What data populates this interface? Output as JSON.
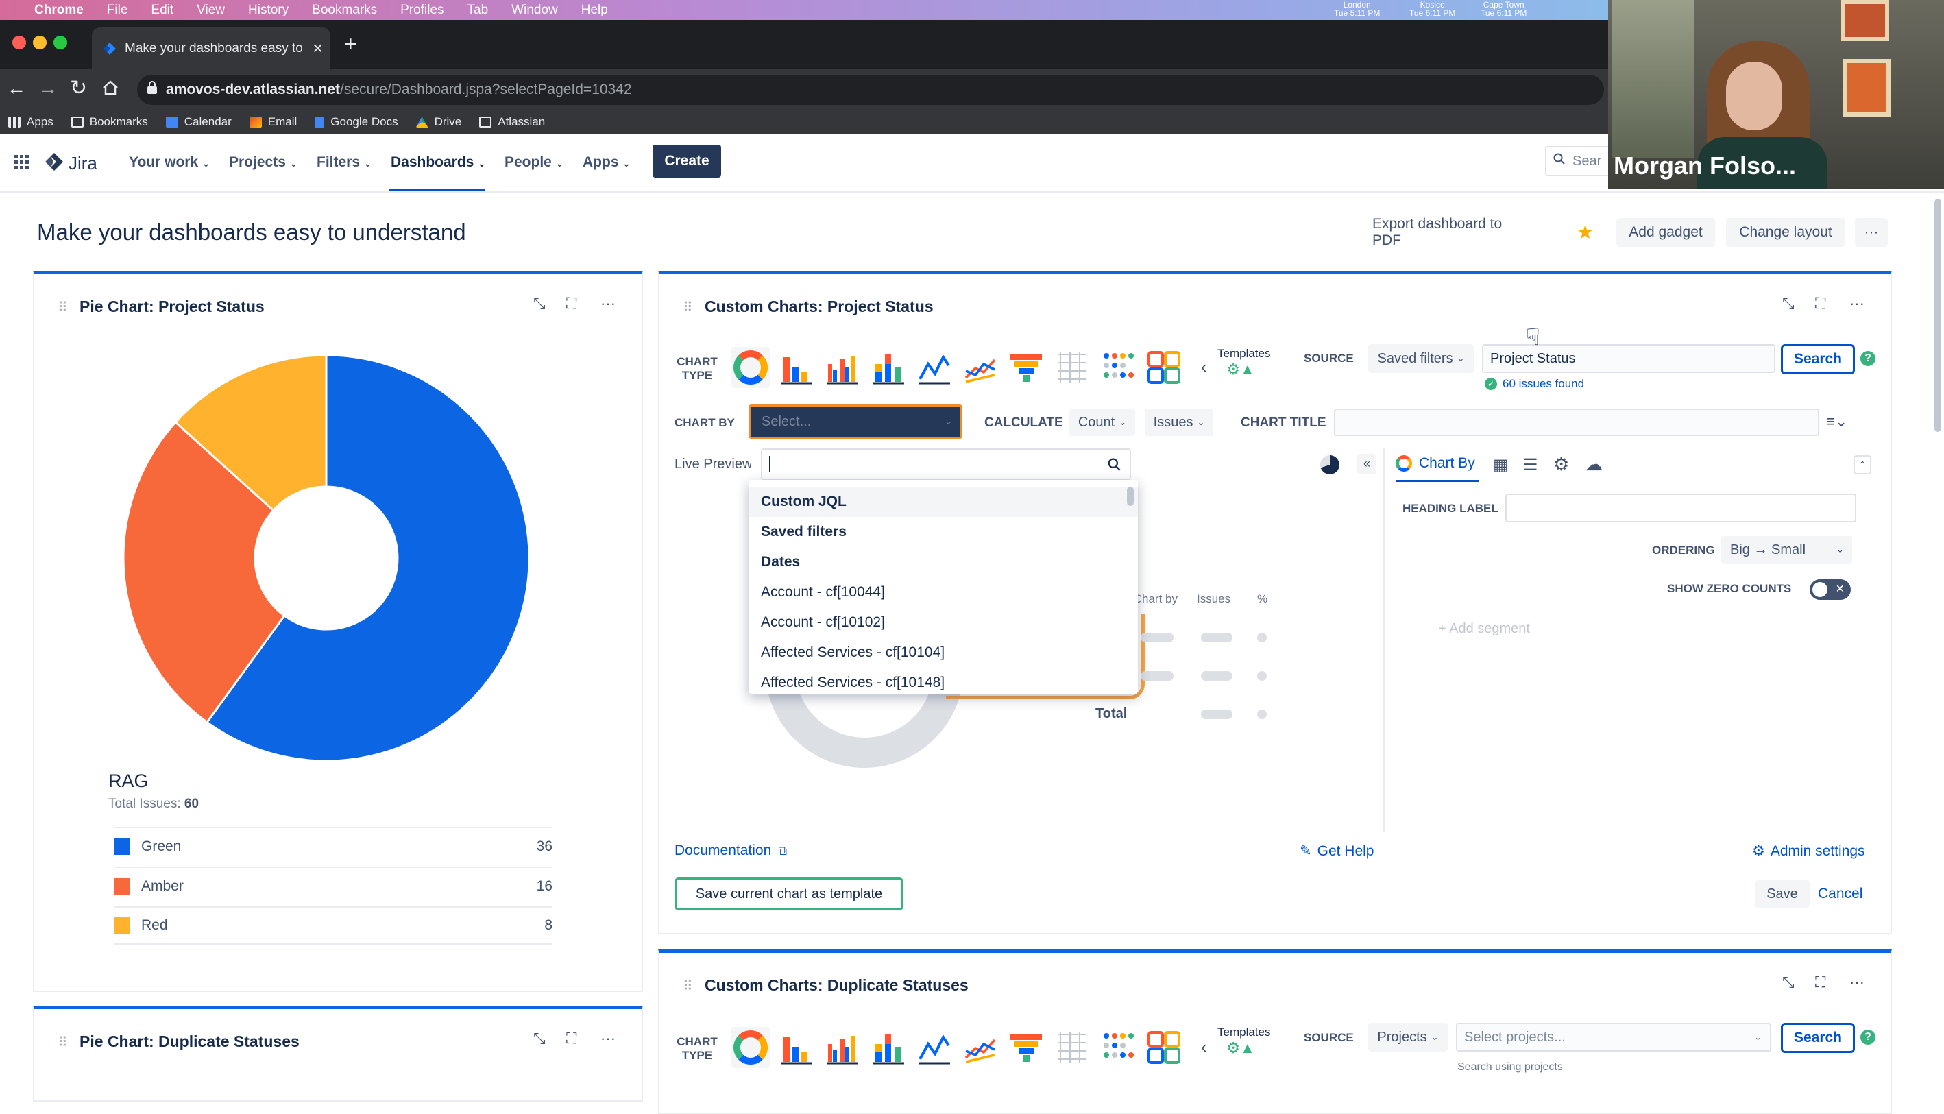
{
  "mac_menu": {
    "app": "Chrome",
    "items": [
      "File",
      "Edit",
      "View",
      "History",
      "Bookmarks",
      "Profiles",
      "Tab",
      "Window",
      "Help"
    ],
    "clocks": [
      {
        "city": "London",
        "time": "Tue 5:11 PM"
      },
      {
        "city": "Kosice",
        "time": "Tue 6:11 PM"
      },
      {
        "city": "Cape Town",
        "time": "Tue 6:11 PM"
      }
    ]
  },
  "browser": {
    "tab_title": "Make your dashboards easy to",
    "tab_close": "×",
    "new_tab": "+",
    "url_host": "amovos-dev.atlassian.net",
    "url_path": "/secure/Dashboard.jspa?selectPageId=10342",
    "bookmarks": [
      "Apps",
      "Bookmarks",
      "Calendar",
      "Email",
      "Google Docs",
      "Drive",
      "Atlassian"
    ]
  },
  "jira_nav": {
    "logo": "Jira",
    "items": [
      "Your work",
      "Projects",
      "Filters",
      "Dashboards",
      "People",
      "Apps"
    ],
    "create": "Create",
    "search_placeholder": "Sear"
  },
  "video": {
    "participant": "Morgan Folso..."
  },
  "page": {
    "title": "Make your dashboards easy to understand",
    "export": "Export dashboard to PDF",
    "add_gadget": "Add gadget",
    "change_layout": "Change layout",
    "more": "···"
  },
  "pie_panel": {
    "title": "Pie Chart: Project Status",
    "legend_title": "RAG",
    "total_label": "Total Issues:",
    "total_value": "60",
    "colors": {
      "Green": "#0c66e4",
      "Amber": "#f7683a",
      "Red": "#ffb22e"
    }
  },
  "chart_data": {
    "type": "pie",
    "donut": true,
    "categories": [
      "Green",
      "Amber",
      "Red"
    ],
    "values": [
      36,
      16,
      8
    ],
    "title": "RAG"
  },
  "custom_panel": {
    "title": "Custom Charts: Project Status",
    "chart_type_label": "CHART TYPE",
    "templates": "Templates",
    "source_label": "SOURCE",
    "source_value": "Saved filters",
    "filter_value": "Project Status",
    "search": "Search",
    "issues_found": "60 issues found",
    "chart_by_label": "CHART BY",
    "chart_by_placeholder": "Select...",
    "calculate_label": "CALCULATE",
    "calc_count": "Count",
    "calc_issues": "Issues",
    "chart_title_label": "CHART TITLE",
    "live_preview": "Live Preview",
    "dropdown": [
      {
        "t": "Custom JQL",
        "h": true
      },
      {
        "t": "Saved filters",
        "h": true
      },
      {
        "t": "Dates",
        "h": true
      },
      {
        "t": "Account - cf[10044]",
        "h": false
      },
      {
        "t": "Account - cf[10102]",
        "h": false
      },
      {
        "t": "Affected Services - cf[10104]",
        "h": false
      },
      {
        "t": "Affected Services - cf[10148]",
        "h": false
      }
    ],
    "table_cols": [
      "Chart by",
      "Issues",
      "%"
    ],
    "table_total": "Total",
    "chart_by_tab": "Chart By",
    "heading_label": "HEADING LABEL",
    "ordering_label": "ORDERING",
    "ordering_value": "Big → Small",
    "show_zero": "SHOW ZERO COUNTS",
    "add_segment": "+ Add segment",
    "documentation": "Documentation",
    "get_help": "Get Help",
    "admin_settings": "Admin settings",
    "save_template": "Save current chart as template",
    "save": "Save",
    "cancel": "Cancel"
  },
  "pie_panel2": {
    "title": "Pie Chart: Duplicate Statuses"
  },
  "custom_panel2": {
    "title": "Custom Charts: Duplicate Statuses",
    "chart_type_label": "CHART TYPE",
    "templates": "Templates",
    "source_label": "SOURCE",
    "source_value": "Projects",
    "projects_placeholder": "Select projects...",
    "search": "Search",
    "hint": "Search using projects"
  }
}
